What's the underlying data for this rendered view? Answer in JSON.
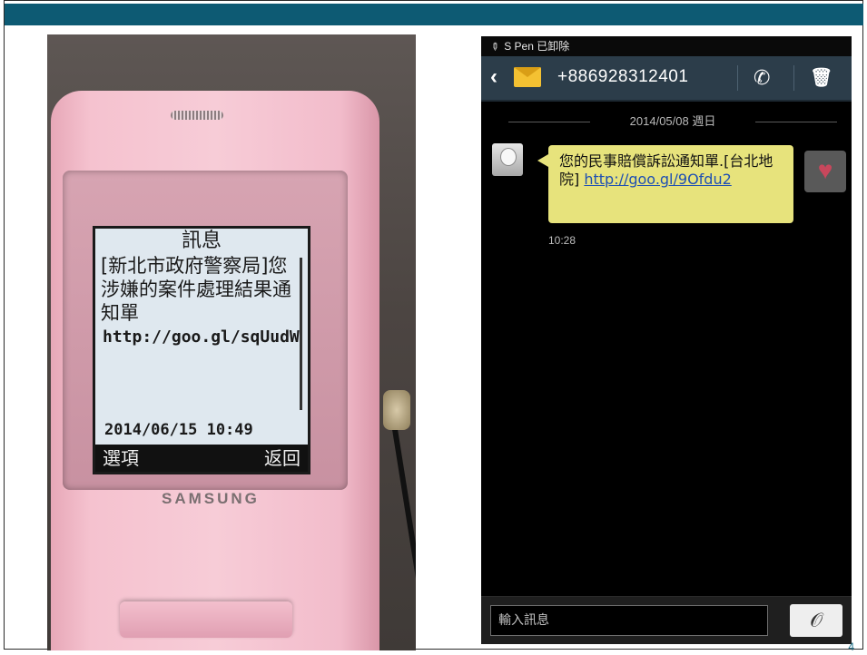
{
  "slide": {
    "page_number": "4",
    "colors": {
      "header_bar": "#0d5a73"
    }
  },
  "left_phone": {
    "screen_title": "訊息",
    "message_text": "[新北市政府警察局]您涉嫌的案件處理結果通知單",
    "message_url": "http://goo.gl/sqUudW",
    "timestamp": "2014/06/15 10:49",
    "softkey_left": "選項",
    "softkey_right": "返回",
    "brand": "SAMSUNG"
  },
  "right_phone": {
    "statusbar_text": "S Pen 已卸除",
    "contact_number": "+886928312401",
    "thread_date": "2014/05/08 週日",
    "message_text": "您的民事賠償訴訟通知單.[台北地院]",
    "message_link": "http://goo.gl/9Ofdu2",
    "message_time": "10:28",
    "input_placeholder": "輸入訊息",
    "icons": {
      "back": "back-arrow-icon",
      "envelope": "envelope-icon",
      "call": "phone-icon",
      "delete": "trash-icon",
      "emoticon": "heart-icon",
      "attach": "paperclip-icon"
    }
  }
}
